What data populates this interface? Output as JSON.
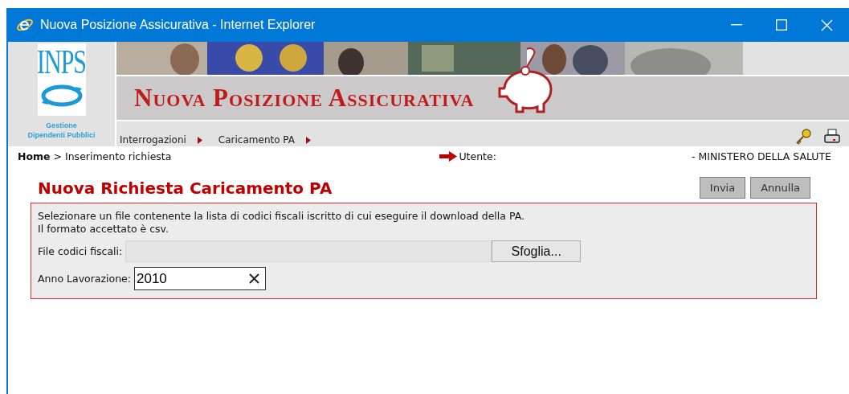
{
  "window": {
    "title": "Nuova Posizione Assicurativa - Internet Explorer"
  },
  "header": {
    "logo_text": "INPS",
    "logo_subtitle": "Gestione Dipendenti Pubblici",
    "banner_title": "Nuova Posizione Assicurativa",
    "menu": [
      {
        "label": "Interrogazioni"
      },
      {
        "label": "Caricamento PA"
      }
    ]
  },
  "breadcrumb": {
    "home": "Home",
    "separator": ">",
    "current": "Inserimento richiesta"
  },
  "user": {
    "label": "Utente:",
    "value": "- MINISTERO DELLA SALUTE"
  },
  "form": {
    "title": "Nuova Richiesta Caricamento PA",
    "buttons": [
      "Invia",
      "Annulla"
    ],
    "description": [
      "Selezionare un file contenente la lista di codici fiscali iscritto di cui eseguire il download della PA.",
      "Il formato accettato è csv."
    ],
    "fields": [
      {
        "kind": "file",
        "label": "File codici fiscali:",
        "button": "Sfoglia..."
      },
      {
        "kind": "text",
        "label": "Anno Lavorazione:",
        "value": "2010"
      }
    ]
  }
}
